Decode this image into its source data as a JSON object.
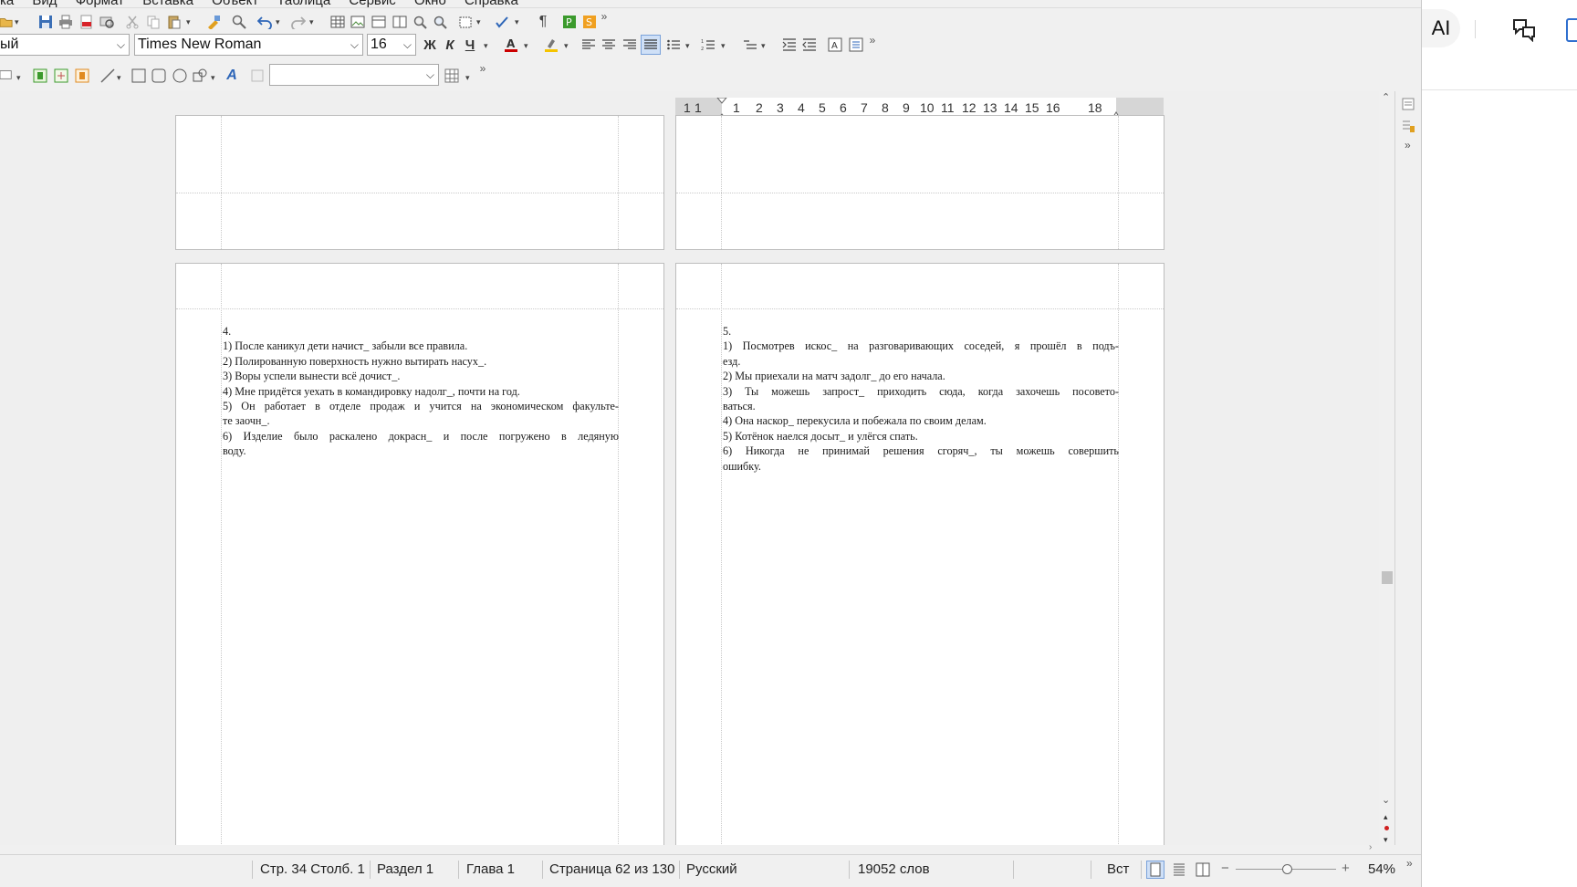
{
  "menu": [
    "ка",
    "Вид",
    "Формат",
    "Вставка",
    "Объект",
    "Таблица",
    "Сервис",
    "Окно",
    "Справка"
  ],
  "toolbar": {
    "paragraph_style": "ый",
    "font_name": "Times New Roman",
    "font_size": "16",
    "bold_label": "Ж",
    "italic_label": "К",
    "underline_label": "Ч",
    "find_field": "",
    "overflow_label": "»"
  },
  "ruler": {
    "numbers": [
      "1",
      "1",
      "1",
      "2",
      "3",
      "4",
      "5",
      "6",
      "7",
      "8",
      "9",
      "10",
      "11",
      "12",
      "13",
      "14",
      "15",
      "16",
      "18"
    ]
  },
  "pages": {
    "left_bottom": {
      "lines": [
        "4.",
        "1) После каникул дети начист_ забыли все правила.",
        "2) Полированную поверхность нужно вытирать насух_.",
        "3) Воры успели вынести всё дочист_.",
        "4) Мне придётся уехать в командировку надолг_, почти на год.",
        "5) Он работает в отделе продаж и учится на экономическом факульте-",
        "те заочн_.",
        "6) Изделие было раскалено докрасн_ и после погружено в ледяную",
        "воду."
      ]
    },
    "right_bottom": {
      "lines": [
        "5.",
        "1) Посмотрев искос_ на разговаривающих соседей, я прошёл в подъ-",
        "езд.",
        "2) Мы приехали на матч задолг_ до его начала.",
        "3) Ты можешь запрост_ приходить сюда, когда захочешь посовето-",
        "ваться.",
        "4) Она наскор_ перекусила и побежала по своим делам.",
        "5) Котёнок наелся досыт_ и улёгся спать.",
        "6) Никогда не принимай решения сгоряч_, ты можешь совершить",
        "ошибку."
      ]
    }
  },
  "status": {
    "page_col": "Стр. 34 Столб. 1",
    "section": "Раздел 1",
    "chapter": "Глава 1",
    "page_of": "Страница 62 из 130",
    "language": "Русский",
    "words": "19052 слов",
    "insert_mode": "Вст",
    "zoom": "54%"
  },
  "right_pane": {
    "ai_label": "AI"
  },
  "colors": {
    "font_color": "#cc0000",
    "highlight": "#f5c400",
    "accent": "#2f6fcf"
  }
}
